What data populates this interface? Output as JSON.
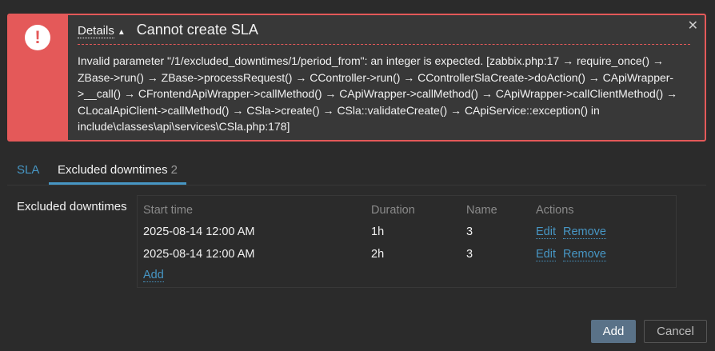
{
  "message": {
    "details_label": "Details",
    "caret": "▲",
    "title": "Cannot create SLA",
    "close": "✕",
    "icon": "!",
    "text": "Invalid parameter \"/1/excluded_downtimes/1/period_from\": an integer is expected. [zabbix.php:17 → require_once() → ZBase->run() → ZBase->processRequest() → CController->run() → CControllerSlaCreate->doAction() → CApiWrapper->__call() → CFrontendApiWrapper->callMethod() → CApiWrapper->callMethod() → CApiWrapper->callClientMethod() → CLocalApiClient->callMethod() → CSla->create() → CSla::validateCreate() → CApiService::exception() in include\\classes\\api\\services\\CSla.php:178]"
  },
  "tabs": {
    "sla": "SLA",
    "excluded": "Excluded downtimes",
    "excluded_count": "2"
  },
  "form": {
    "label": "Excluded downtimes"
  },
  "table": {
    "headers": [
      "Start time",
      "Duration",
      "Name",
      "Actions"
    ],
    "rows": [
      {
        "start": "2025-08-14 12:00 AM",
        "duration": "1h",
        "name": "3",
        "edit": "Edit",
        "remove": "Remove"
      },
      {
        "start": "2025-08-14 12:00 AM",
        "duration": "2h",
        "name": "3",
        "edit": "Edit",
        "remove": "Remove"
      }
    ],
    "add": "Add"
  },
  "buttons": {
    "add": "Add",
    "cancel": "Cancel"
  },
  "colors": {
    "error": "#e45959",
    "accent": "#4796c4",
    "background": "#2b2b2b"
  }
}
